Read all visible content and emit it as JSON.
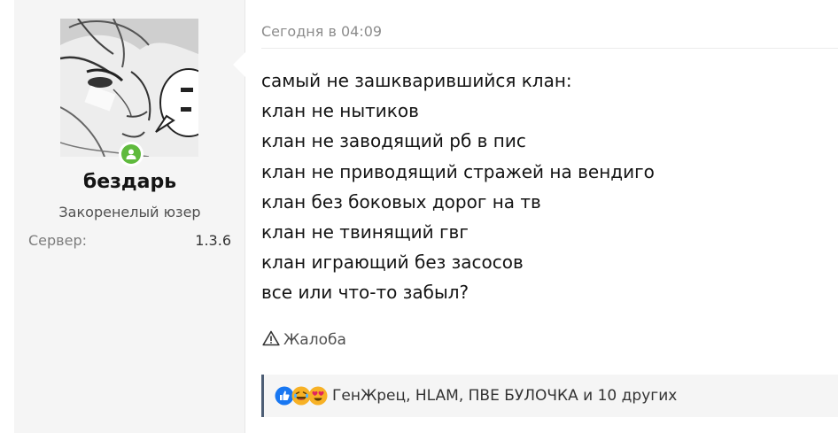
{
  "user": {
    "name": "бездарь",
    "title": "Закоренелый юзер",
    "extra_label": "Сервер:",
    "extra_value": "1.3.6"
  },
  "post": {
    "date": "Сегодня в 04:09",
    "lines": [
      "самый не зашкварившийся клан:",
      "клан не нытиков",
      "клан не заводящий рб в пис",
      "клан не приводящий стражей на вендиго",
      "клан без боковых дорог на тв",
      "клан не твинящий гвг",
      "клан играющий без засосов",
      "все или что-то забыл?"
    ],
    "report_label": "Жалоба"
  },
  "reactions": {
    "icons": [
      "like-icon",
      "laugh-icon",
      "love-icon"
    ],
    "text": "ГенЖрец, HLAM, ПВЕ БУЛОЧКА и 10 других"
  },
  "colors": {
    "online": "#5fba3d",
    "reaction_border": "#4d5e75",
    "cell_bg": "#f5f5f5"
  }
}
